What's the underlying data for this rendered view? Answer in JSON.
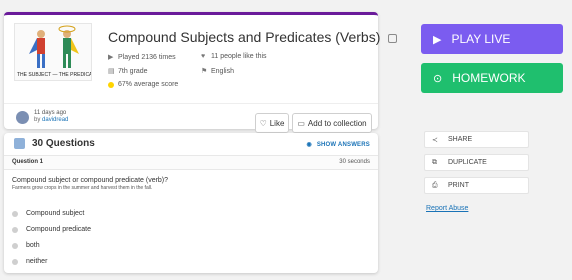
{
  "quiz": {
    "title": "Compound Subjects and Predicates (Verbs)",
    "thumbnail_caption": "THE SUBJECT — THE PREDICATE",
    "played": "Played 2136 times",
    "likes": "11 people like this",
    "grade": "7th grade",
    "language": "English",
    "average": "67% average score",
    "created_ago": "11 days ago",
    "by_label": "by",
    "author": "davidread",
    "like_label": "Like",
    "collection_label": "Add to collection"
  },
  "questions": {
    "count_label": "30 Questions",
    "show_answers_label": "SHOW ANSWERS",
    "current": {
      "number_label": "Question 1",
      "time_label": "30 seconds",
      "text": "Compound subject or compound predicate (verb)?",
      "subtext": "Farmers grow crops in the summer and harvest them in the fall.",
      "options": [
        "Compound subject",
        "Compound predicate",
        "both",
        "neither"
      ]
    }
  },
  "actions": {
    "play_live_label": "PLAY LIVE",
    "homework_label": "HOMEWORK",
    "share_label": "SHARE",
    "duplicate_label": "DUPLICATE",
    "print_label": "PRINT",
    "report_label": "Report Abuse"
  },
  "colors": {
    "accent_purple": "#6a1b9a",
    "play_live": "#7b5cf0",
    "homework": "#1fbf6e",
    "link": "#1a73b7"
  }
}
